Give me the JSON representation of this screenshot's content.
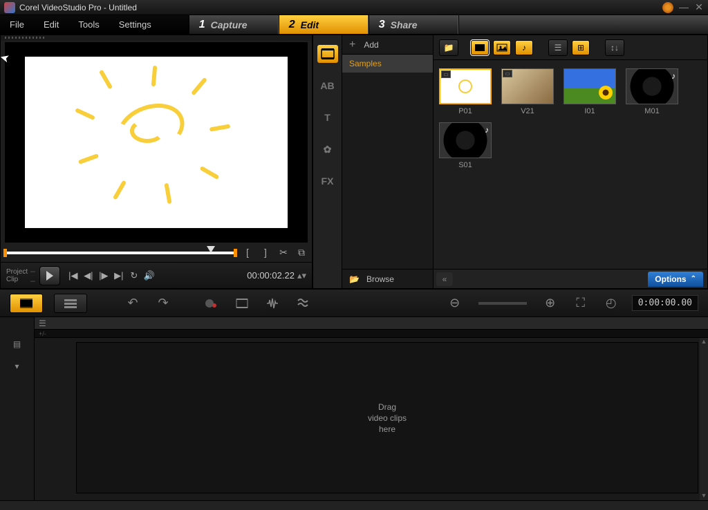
{
  "titlebar": {
    "title": "Corel VideoStudio Pro - Untitled"
  },
  "menu": {
    "file": "File",
    "edit": "Edit",
    "tools": "Tools",
    "settings": "Settings"
  },
  "steps": [
    {
      "num": "1",
      "label": "Capture",
      "active": false
    },
    {
      "num": "2",
      "label": "Edit",
      "active": true
    },
    {
      "num": "3",
      "label": "Share",
      "active": false
    }
  ],
  "preview": {
    "mode_project": "Project",
    "mode_clip": "Clip",
    "timecode": "00:00:02.22",
    "mark_in": "[",
    "mark_out": "]"
  },
  "library": {
    "add": "Add",
    "categories": [
      "Samples"
    ],
    "browse": "Browse",
    "options": "Options",
    "tabs": [
      "media",
      "AB",
      "T",
      "graphic",
      "FX"
    ],
    "thumbs": [
      {
        "name": "P01",
        "kind": "project",
        "selected": true
      },
      {
        "name": "V21",
        "kind": "video",
        "selected": false
      },
      {
        "name": "I01",
        "kind": "image",
        "selected": false
      },
      {
        "name": "M01",
        "kind": "audio",
        "selected": false
      },
      {
        "name": "S01",
        "kind": "audio",
        "selected": false
      }
    ]
  },
  "timeline": {
    "time": "0:00:00.00",
    "drop_hint": "Drag\nvideo clips\nhere",
    "strip": "+/-"
  }
}
